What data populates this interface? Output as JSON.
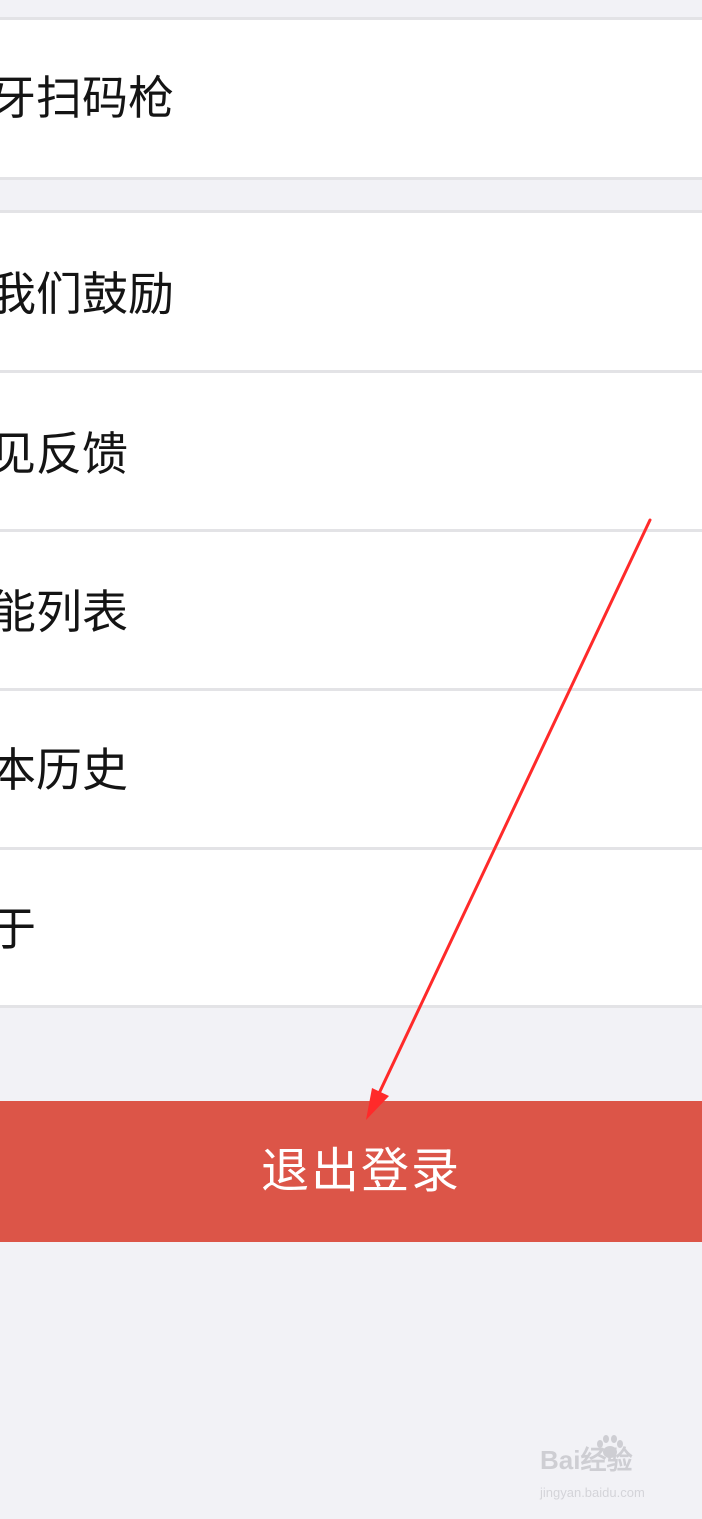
{
  "colors": {
    "background": "#f2f2f6",
    "row_background": "#ffffff",
    "divider": "#e3e3e6",
    "logout_background": "#dc5548",
    "annotation_arrow": "#ff2a2a"
  },
  "settings": {
    "items": [
      {
        "label": "牙扫码枪"
      },
      {
        "label": "我们鼓励"
      },
      {
        "label": "见反馈"
      },
      {
        "label": "能列表"
      },
      {
        "label": "本历史"
      },
      {
        "label": "于"
      }
    ]
  },
  "logout": {
    "label": "退出登录"
  },
  "watermark": {
    "logo": "Bai经验",
    "url": "jingyan.baidu.com"
  }
}
